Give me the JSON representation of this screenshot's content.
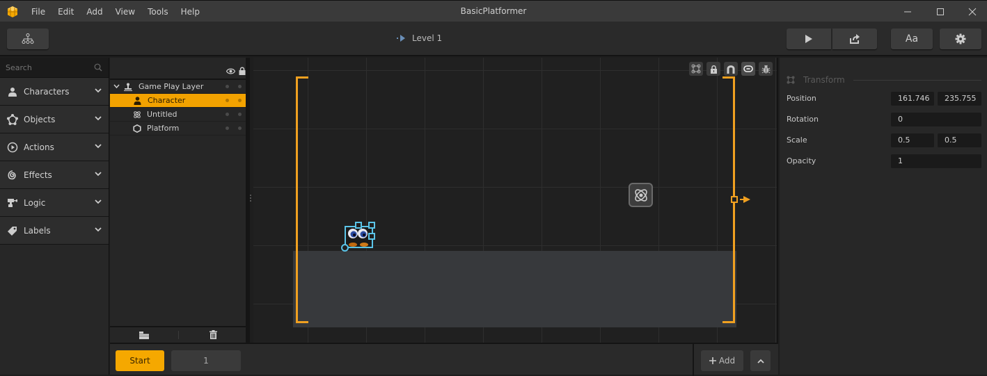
{
  "window": {
    "title": "BasicPlatformer",
    "menu": [
      "File",
      "Edit",
      "Add",
      "View",
      "Tools",
      "Help"
    ],
    "controls": {
      "minimize": "minimize-icon",
      "maximize": "maximize-icon",
      "close": "close-icon"
    }
  },
  "toolbar": {
    "hierarchy_icon": "hierarchy-icon",
    "level_label": "Level 1",
    "play_icon": "play-icon",
    "share_icon": "share-icon",
    "font_button": "Aa",
    "settings_icon": "gear-icon"
  },
  "library": {
    "search_placeholder": "Search",
    "categories": [
      {
        "label": "Characters",
        "icon": "person-icon"
      },
      {
        "label": "Objects",
        "icon": "objects-icon"
      },
      {
        "label": "Actions",
        "icon": "play-circle-icon"
      },
      {
        "label": "Effects",
        "icon": "spiral-icon"
      },
      {
        "label": "Logic",
        "icon": "logic-icon"
      },
      {
        "label": "Labels",
        "icon": "tag-icon"
      }
    ]
  },
  "layers": {
    "header_icons": [
      "eye-icon",
      "lock-icon"
    ],
    "layer_name": "Game Play Layer",
    "items": [
      {
        "name": "Character",
        "icon": "person-icon",
        "selected": true
      },
      {
        "name": "Untitled",
        "icon": "atom-icon",
        "selected": false
      },
      {
        "name": "Platform",
        "icon": "hexagon-icon",
        "selected": false
      }
    ],
    "footer_icons": [
      "folder-icon",
      "trash-icon"
    ]
  },
  "canvas": {
    "tools": [
      "transform-icon",
      "lock-icon",
      "magnet-icon",
      "link-icon",
      "bug-icon"
    ],
    "accent": "#f5a800",
    "selection_color": "#5bc4e8"
  },
  "timeline": {
    "start_label": "Start",
    "frame_value": "1",
    "add_label": "Add"
  },
  "inspector": {
    "section": "Transform",
    "position": {
      "label": "Position",
      "x": "161.746",
      "y": "235.755"
    },
    "rotation": {
      "label": "Rotation",
      "value": "0"
    },
    "scale": {
      "label": "Scale",
      "x": "0.5",
      "y": "0.5"
    },
    "opacity": {
      "label": "Opacity",
      "value": "1"
    }
  }
}
